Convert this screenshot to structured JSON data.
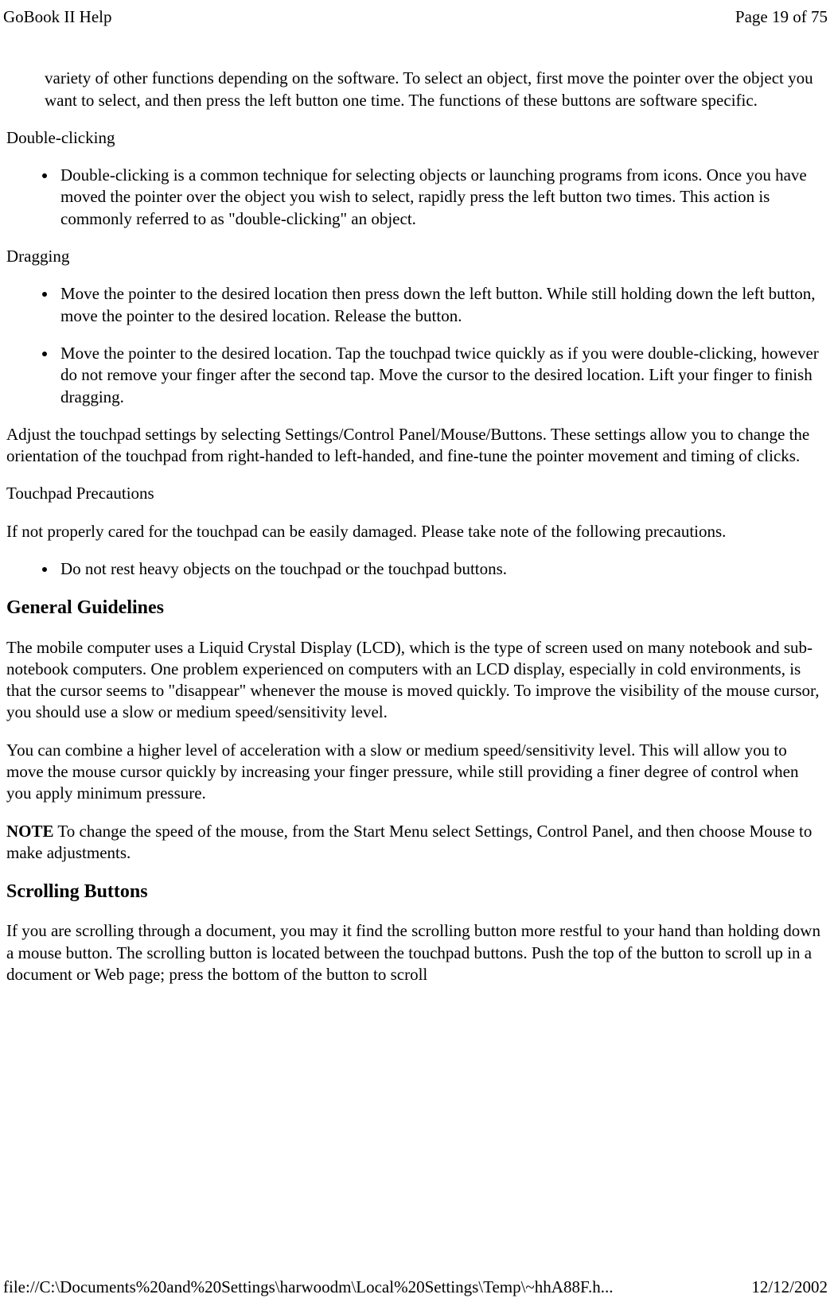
{
  "header": {
    "title": "GoBook II Help",
    "page_info": "Page 19 of 75"
  },
  "content": {
    "intro_continuation": "variety of other functions depending on the software. To select an object, first move the pointer over the object you want to select, and then press the left button one time. The functions of these buttons are software specific.",
    "double_clicking": {
      "label": "Double-clicking",
      "item1": "Double-clicking is a common technique for selecting objects or launching programs from icons. Once you have moved the pointer over the object you wish to select, rapidly press the left button two times. This action is commonly referred to as \"double-clicking\" an object."
    },
    "dragging": {
      "label": "Dragging",
      "item1": "Move the pointer to the desired location then press down the left button. While still holding down the left button, move the pointer to the desired location. Release the button.",
      "item2": "Move the pointer to the desired location. Tap the touchpad twice quickly as if you were double-clicking, however do not remove your finger after the second tap. Move the cursor to the desired location. Lift your finger to finish dragging."
    },
    "adjust_para": "Adjust the touchpad settings by selecting Settings/Control Panel/Mouse/Buttons. These settings allow you to change the orientation of the touchpad from right-handed to left-handed, and fine-tune the pointer movement and timing of clicks.",
    "precautions": {
      "label": "Touchpad Precautions",
      "intro": "If not properly cared for the touchpad can be easily damaged. Please take note of the following precautions.",
      "item1": " Do not rest heavy objects on the touchpad or the touchpad buttons."
    },
    "general_guidelines": {
      "heading": "General Guidelines",
      "para1": "The mobile computer uses a Liquid Crystal Display (LCD), which is the type of screen used on many notebook and sub-notebook computers. One problem experienced on computers with an LCD display, especially in cold environments, is that the cursor seems to \"disappear\" whenever the mouse is moved quickly. To improve the visibility of the mouse cursor, you should use a slow or medium speed/sensitivity level.",
      "para2": "You can combine a higher level of acceleration with a slow or medium speed/sensitivity level. This will allow you to move the mouse cursor quickly by increasing your finger pressure, while still providing a finer degree of control when you apply minimum pressure.",
      "note_label": "NOTE",
      "note_text": "  To change the speed of the mouse, from the Start Menu select Settings, Control Panel, and then choose Mouse to make adjustments."
    },
    "scrolling_buttons": {
      "heading": "Scrolling Buttons",
      "para1": "If you are scrolling through a document, you may it find the scrolling button more restful to your hand than holding down a mouse button.  The scrolling button is located between the touchpad buttons.  Push the top of the button to scroll up in a document or Web page; press the bottom of the button to scroll"
    }
  },
  "footer": {
    "path": "file://C:\\Documents%20and%20Settings\\harwoodm\\Local%20Settings\\Temp\\~hhA88F.h...",
    "date": "12/12/2002"
  }
}
